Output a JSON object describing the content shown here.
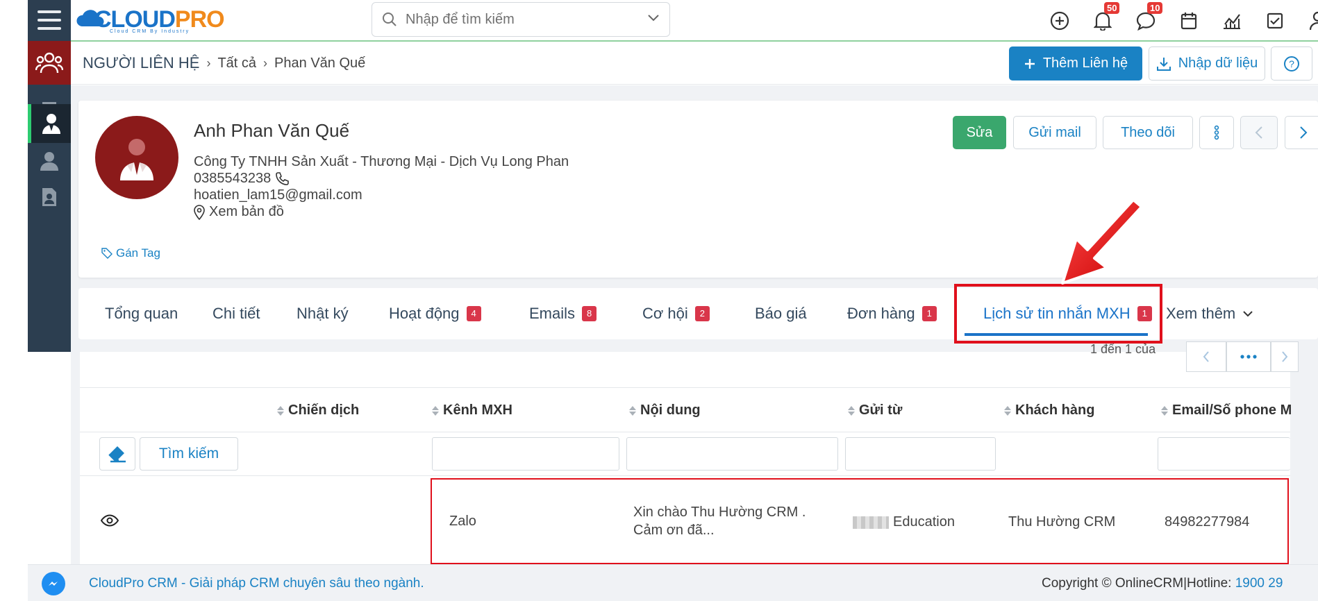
{
  "app": {
    "logo_main": "CLOUD",
    "logo_accent": "PRO",
    "logo_tagline": "Cloud CRM By Industry"
  },
  "search": {
    "placeholder": "Nhập để tìm kiếm"
  },
  "notifications": {
    "bell_count": "50",
    "chat_count": "10"
  },
  "breadcrumb": {
    "root": "NGƯỜI LIÊN HỆ",
    "level1": "Tất cả",
    "level2": "Phan Văn Quế"
  },
  "header_actions": {
    "add_contact": "Thêm Liên hệ",
    "import_data": "Nhập dữ liệu"
  },
  "contact": {
    "name": "Anh Phan Văn Quế",
    "company": "Công Ty TNHH Sản Xuất - Thương Mại - Dịch Vụ Long Phan",
    "phone": "0385543238",
    "email": "hoatien_lam15@gmail.com",
    "map_link": "Xem bản đồ",
    "tag_link": "Gán Tag"
  },
  "contact_actions": {
    "edit": "Sửa",
    "send_mail": "Gửi mail",
    "follow": "Theo dõi"
  },
  "tabs": [
    {
      "label": "Tổng quan",
      "count": ""
    },
    {
      "label": "Chi tiết",
      "count": ""
    },
    {
      "label": "Nhật ký",
      "count": ""
    },
    {
      "label": "Hoạt động",
      "count": "4"
    },
    {
      "label": "Emails",
      "count": "8"
    },
    {
      "label": "Cơ hội",
      "count": "2"
    },
    {
      "label": "Báo giá",
      "count": ""
    },
    {
      "label": "Đơn hàng",
      "count": "1"
    },
    {
      "label": "Lịch sử tin nhắn MXH",
      "count": "1"
    },
    {
      "label": "Xem thêm",
      "count": ""
    }
  ],
  "active_tab": "Lịch sử tin nhắn MXH",
  "pager": {
    "text": "1 đến 1 của"
  },
  "table": {
    "columns": [
      "Chiến dịch",
      "Kênh MXH",
      "Nội dung",
      "Gửi từ",
      "Khách hàng",
      "Email/Số phone M"
    ],
    "search_button": "Tìm kiếm",
    "rows": [
      {
        "campaign": "",
        "channel": "Zalo",
        "content_line1": "Xin chào Thu Hường CRM .",
        "content_line2": "Cảm ơn đã...",
        "sent_from": "Education",
        "customer": "Thu Hường CRM",
        "phone": "84982277984"
      }
    ]
  },
  "footer": {
    "left": "CloudPro CRM - Giải pháp CRM chuyên sâu theo ngành.",
    "right": "Copyright © OnlineCRM|Hotline: ",
    "hotline": "1900 29"
  },
  "colors": {
    "sidebar": "#2c3e50",
    "accent_blue": "#1a82c4",
    "green_button": "#3aa76d",
    "badge_red": "#d9364a",
    "highlight_red": "#e0101c"
  }
}
